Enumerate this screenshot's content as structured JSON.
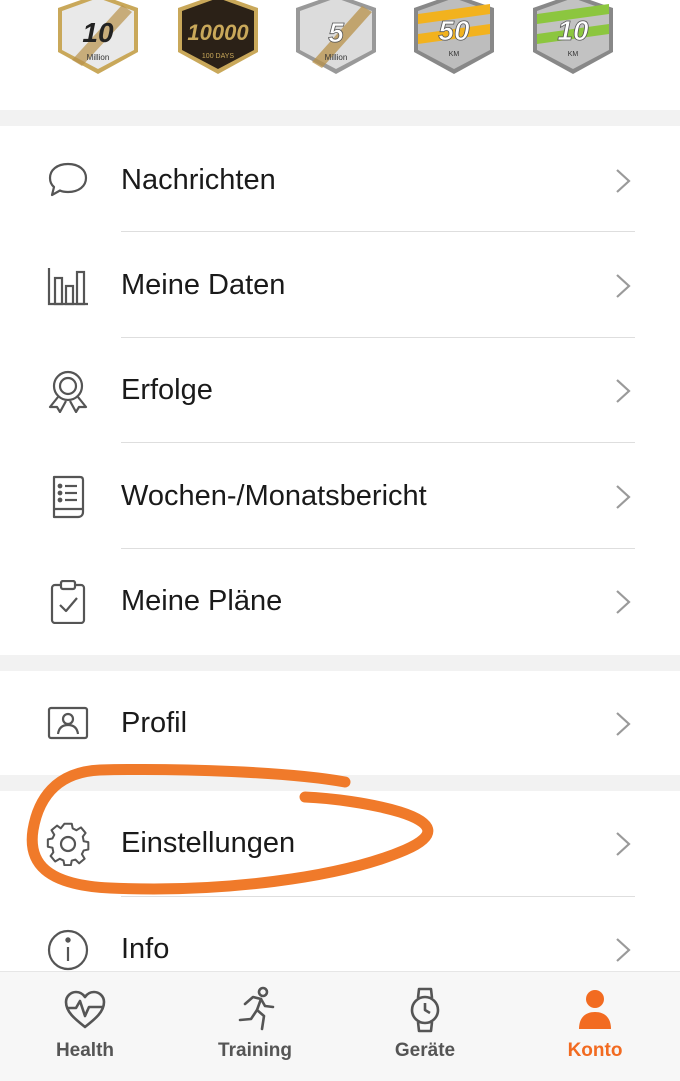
{
  "badges": [
    {
      "value": "10",
      "sub": "Million",
      "style": "silver-gold"
    },
    {
      "value": "10000",
      "sub": "100 DAYS",
      "style": "black-gold"
    },
    {
      "value": "5",
      "sub": "Million",
      "style": "silver-gold"
    },
    {
      "value": "50",
      "sub": "KM",
      "style": "orange-stripe"
    },
    {
      "value": "10",
      "sub": "KM",
      "style": "green-stripe"
    }
  ],
  "menu_main": [
    {
      "label": "Nachrichten",
      "icon": "chat-bubble-icon"
    },
    {
      "label": "Meine Daten",
      "icon": "bar-chart-icon"
    },
    {
      "label": "Erfolge",
      "icon": "medal-icon"
    },
    {
      "label": "Wochen-/Monatsbericht",
      "icon": "report-icon"
    },
    {
      "label": "Meine Pläne",
      "icon": "clipboard-check-icon"
    }
  ],
  "menu_profile": [
    {
      "label": "Profil",
      "icon": "id-card-icon"
    }
  ],
  "menu_settings": [
    {
      "label": "Einstellungen",
      "icon": "gear-icon"
    },
    {
      "label": "Info",
      "icon": "info-icon"
    }
  ],
  "tabs": [
    {
      "label": "Health",
      "icon": "heart-pulse-icon",
      "active": false
    },
    {
      "label": "Training",
      "icon": "runner-icon",
      "active": false
    },
    {
      "label": "Geräte",
      "icon": "watch-icon",
      "active": false
    },
    {
      "label": "Konto",
      "icon": "user-icon",
      "active": true
    }
  ],
  "colors": {
    "accent": "#f26b21",
    "annotation": "#f07a2a",
    "icon_gray": "#555555",
    "section_gap": "#f2f2f2"
  }
}
